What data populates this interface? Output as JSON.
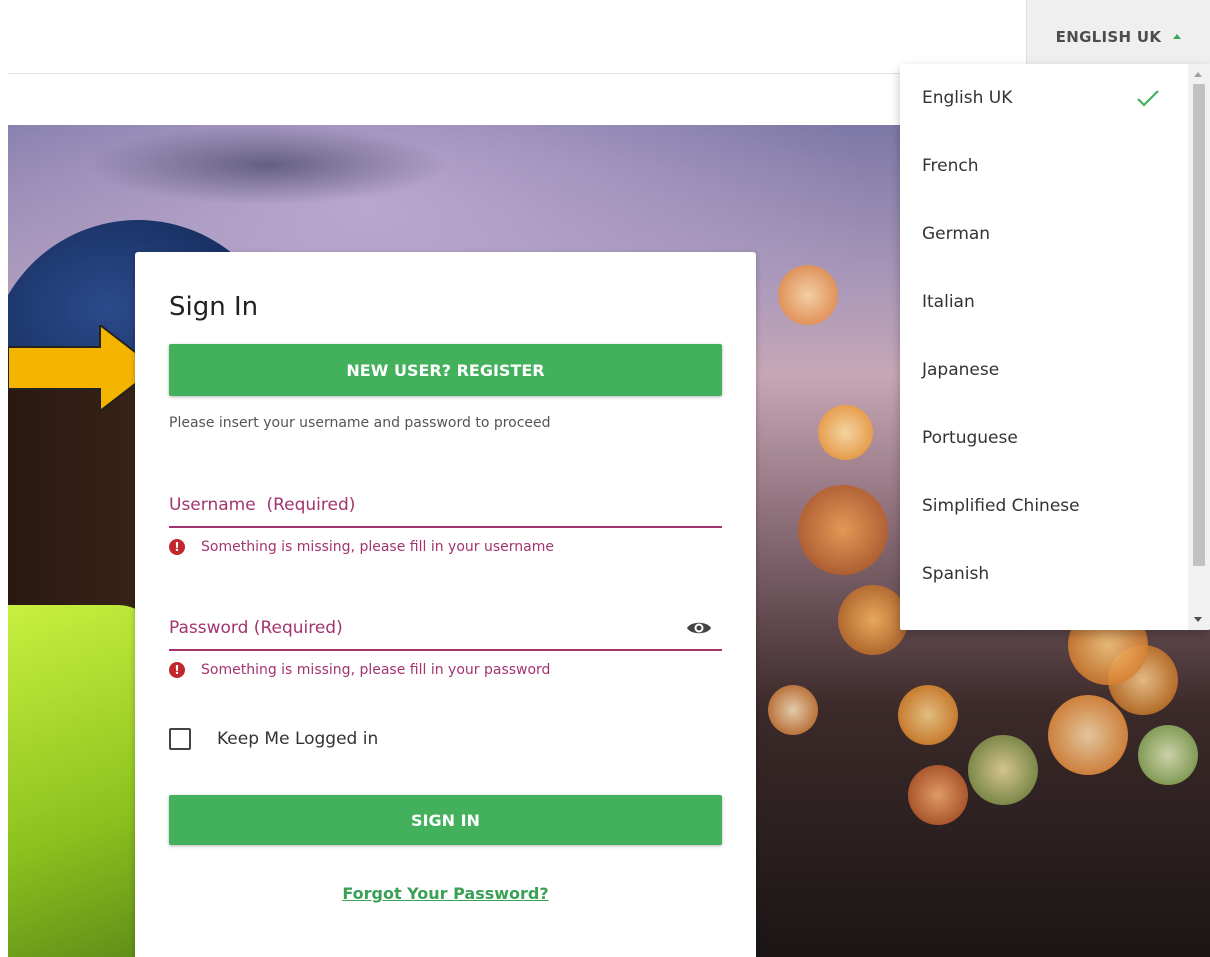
{
  "header": {
    "language_button_label": "ENGLISH UK"
  },
  "language_menu": {
    "selected": "English UK",
    "items": [
      {
        "label": "English UK"
      },
      {
        "label": "French"
      },
      {
        "label": "German"
      },
      {
        "label": "Italian"
      },
      {
        "label": "Japanese"
      },
      {
        "label": "Portuguese"
      },
      {
        "label": "Simplified Chinese"
      },
      {
        "label": "Spanish"
      }
    ]
  },
  "signin": {
    "title": "Sign In",
    "register_label": "NEW USER? REGISTER",
    "instructions": "Please insert your username and password to proceed",
    "username": {
      "value": "",
      "placeholder": "Username  (Required)",
      "error": "Something is missing, please fill in your username"
    },
    "password": {
      "value": "",
      "placeholder": "Password (Required)",
      "error": "Something is missing, please fill in your password"
    },
    "keep_logged_in_label": "Keep Me Logged in",
    "keep_logged_in_checked": false,
    "signin_label": "SIGN IN",
    "forgot_label": "Forgot Your Password?"
  },
  "colors": {
    "accent_green": "#43b05c",
    "error_magenta": "#a3346f",
    "error_icon_red": "#c1272d",
    "annotation_arrow": "#f5b400"
  },
  "icons": {
    "language_caret": "caret-up-icon",
    "selected_check": "check-icon",
    "password_toggle": "eye-icon",
    "error": "exclamation-circle-icon"
  }
}
